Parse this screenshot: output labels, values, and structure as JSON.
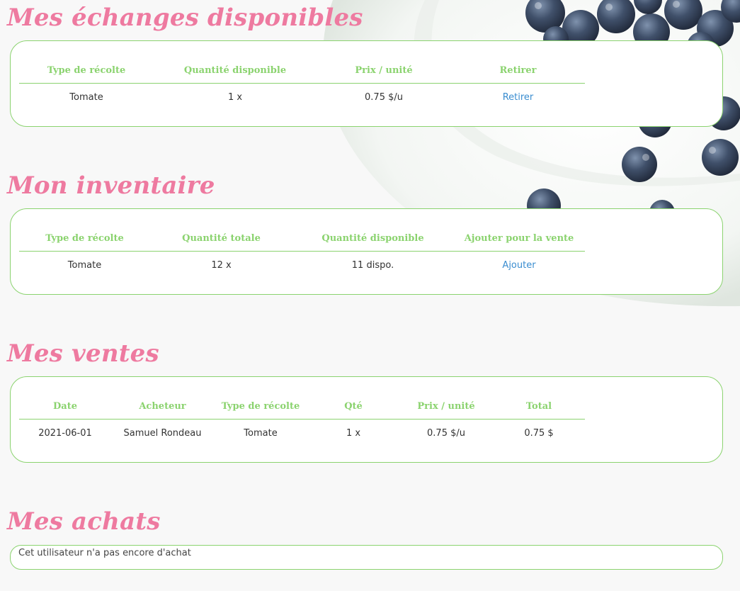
{
  "colors": {
    "title_pink": "#ee7aa0",
    "accent_green": "#8bd36f",
    "link_blue": "#3a8dd0",
    "page_bg": "#f8f8f8"
  },
  "background": {
    "decoration_icon": "blueberries-on-plate"
  },
  "trades": {
    "title": "Mes échanges disponibles",
    "headers": [
      "Type de récolte",
      "Quantité disponible",
      "Prix / unité",
      "Retirer"
    ],
    "rows": [
      {
        "crop": "Tomate",
        "quantity": "1 x",
        "price": "0.75 $/u",
        "action": "Retirer"
      }
    ]
  },
  "inventory": {
    "title": "Mon inventaire",
    "headers": [
      "Type de récolte",
      "Quantité totale",
      "Quantité disponible",
      "Ajouter pour la vente"
    ],
    "rows": [
      {
        "crop": "Tomate",
        "total": "12 x",
        "available": "11 dispo.",
        "action": "Ajouter"
      }
    ]
  },
  "sales": {
    "title": "Mes ventes",
    "headers": [
      "Date",
      "Acheteur",
      "Type de récolte",
      "Qté",
      "Prix / unité",
      "Total"
    ],
    "rows": [
      {
        "date": "2021-06-01",
        "buyer": "Samuel Rondeau",
        "crop": "Tomate",
        "qty": "1 x",
        "price": "0.75 $/u",
        "total": "0.75 $"
      }
    ]
  },
  "purchases": {
    "title": "Mes achats",
    "empty_message": "Cet utilisateur n'a pas encore d'achat"
  }
}
